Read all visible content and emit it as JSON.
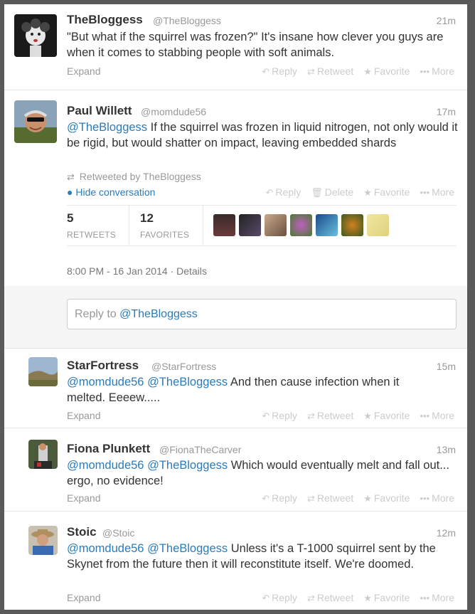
{
  "tweets": [
    {
      "name": "TheBloggess",
      "handle": "@TheBloggess",
      "time": "21m",
      "text": "\"But what if the squirrel was frozen?\"  It's insane how clever you guys are when it comes to stabbing people with soft animals.",
      "expand": "Expand"
    },
    {
      "name": "Paul Willett",
      "handle": "@momdude56",
      "time": "17m",
      "mention1": "@TheBloggess",
      "text": " If the squirrel was frozen in liquid nitrogen, not only would it be rigid, but would shatter on impact, leaving embedded shards",
      "retweeted_by": "Retweeted by TheBloggess",
      "hide_conversation": "Hide conversation",
      "retweets_count": "5",
      "retweets_label": "RETWEETS",
      "favorites_count": "12",
      "favorites_label": "FAVORITES",
      "timestamp": "8:00 PM - 16 Jan 2014",
      "details": "Details"
    },
    {
      "name": "StarFortress",
      "handle": "@StarFortress",
      "time": "15m",
      "mention1": "@momdude56",
      "mention2": "@TheBloggess",
      "text": " And then cause infection when it melted. Eeeew.....",
      "expand": "Expand"
    },
    {
      "name": "Fiona Plunkett",
      "handle": "@FionaTheCarver",
      "time": "13m",
      "mention1": "@momdude56",
      "mention2": "@TheBloggess",
      "text": " Which would eventually melt and fall out... ergo, no evidence!",
      "expand": "Expand"
    },
    {
      "name": "Stoic",
      "handle": "@Stoic",
      "time": "12m",
      "mention1": "@momdude56",
      "mention2": "@TheBloggess",
      "text": " Unless it's a T-1000 squirrel sent by the Skynet from the future then it will reconstitute itself. We're doomed.",
      "expand": "Expand"
    }
  ],
  "actions": {
    "reply": "Reply",
    "retweet": "Retweet",
    "favorite": "Favorite",
    "more": "More",
    "delete": "Delete"
  },
  "reply_box": {
    "prefix": "Reply to ",
    "mention": "@TheBloggess"
  },
  "colors": {
    "link": "#2b7bb9",
    "muted": "#999999",
    "action": "#cccccc"
  }
}
